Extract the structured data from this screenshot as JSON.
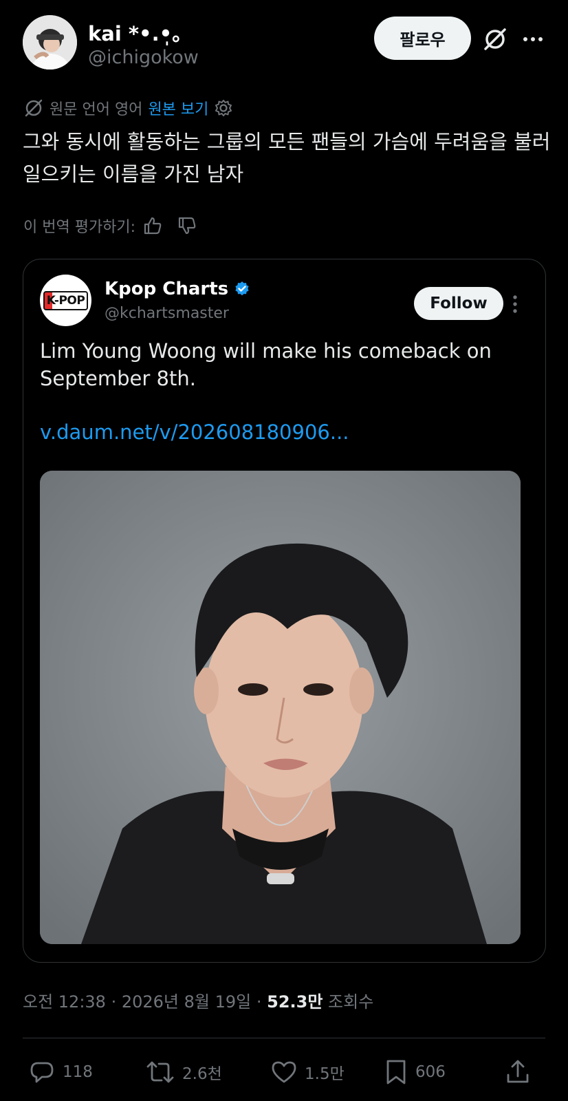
{
  "author": {
    "name": "kai *•.•̩。",
    "handle": "@ichigokow",
    "avatar_icon": "user-avatar"
  },
  "header": {
    "follow_label": "팔로우",
    "grok_icon": "grok-icon",
    "more_icon": "more-horizontal-icon"
  },
  "translation": {
    "source_label": "원문 언어 영어",
    "view_original": "원본 보기",
    "settings_icon": "gear-icon"
  },
  "tweet": {
    "text": "그와 동시에 활동하는 그룹의 모든 팬들의 가슴에 두려움을 불러일으키는 이름을 가진 남자"
  },
  "rating": {
    "label": "이 번역 평가하기:",
    "up_icon": "thumbs-up-icon",
    "down_icon": "thumbs-down-icon"
  },
  "quote": {
    "avatar_text": "K-POP",
    "name": "Kpop Charts",
    "handle": "@kchartsmaster",
    "follow_label": "Follow",
    "text": "Lim Young Woong will make his comeback on September 8th.",
    "link": "v.daum.net/v/202608180906...",
    "verified_color": "#1d9bf0"
  },
  "meta": {
    "time": "오전 12:38 · 2026년 8월 19일 · ",
    "views_count": "52.3만",
    "views_label": " 조회수"
  },
  "actions": {
    "replies": "118",
    "reposts": "2.6천",
    "likes": "1.5만",
    "bookmarks": "606"
  },
  "colors": {
    "background": "#000000",
    "accent": "#1d9bf0",
    "muted": "#71767b"
  }
}
